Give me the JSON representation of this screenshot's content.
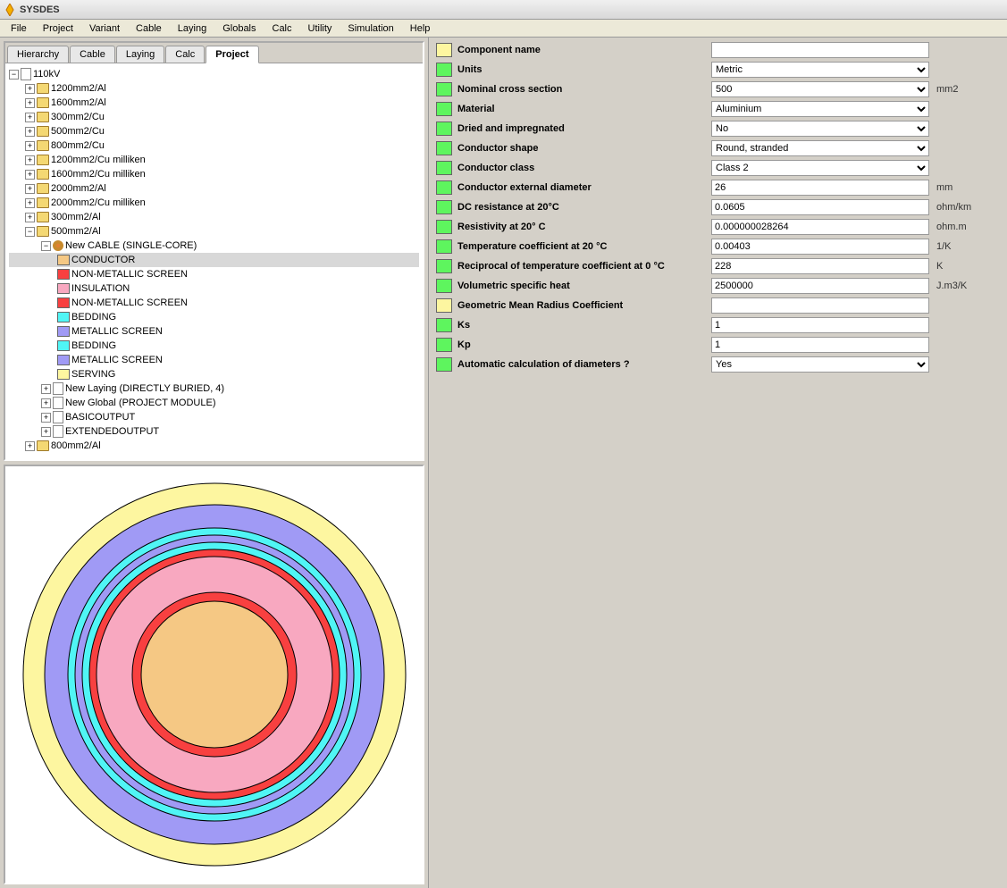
{
  "app": {
    "title": "SYSDES"
  },
  "menu": {
    "items": [
      "File",
      "Project",
      "Variant",
      "Cable",
      "Laying",
      "Globals",
      "Calc",
      "Utility",
      "Simulation",
      "Help"
    ]
  },
  "tabs": {
    "items": [
      "Hierarchy",
      "Cable",
      "Laying",
      "Calc",
      "Project"
    ],
    "active": 4
  },
  "tree": {
    "root": "110kV",
    "folders": [
      "1200mm2/Al",
      "1600mm2/Al",
      "300mm2/Cu",
      "500mm2/Cu",
      "800mm2/Cu",
      "1200mm2/Cu milliken",
      "1600mm2/Cu milliken",
      "2000mm2/Al",
      "2000mm2/Cu milliken",
      "300mm2/Al"
    ],
    "open_folder": "500mm2/Al",
    "cable_node": "New CABLE (SINGLE-CORE)",
    "layers": [
      {
        "label": "CONDUCTOR",
        "color": "c-orange",
        "selected": true
      },
      {
        "label": "NON-METALLIC SCREEN",
        "color": "c-red"
      },
      {
        "label": "INSULATION",
        "color": "c-pink"
      },
      {
        "label": "NON-METALLIC SCREEN",
        "color": "c-red"
      },
      {
        "label": "BEDDING",
        "color": "c-cyan"
      },
      {
        "label": "METALLIC SCREEN",
        "color": "c-purple"
      },
      {
        "label": "BEDDING",
        "color": "c-cyan"
      },
      {
        "label": "METALLIC SCREEN",
        "color": "c-purple"
      },
      {
        "label": "SERVING",
        "color": "c-yellow"
      }
    ],
    "siblings": [
      "New Laying (DIRECTLY BURIED, 4)",
      "New Global (PROJECT MODULE)",
      "BASICOUTPUT",
      "EXTENDEDOUTPUT"
    ],
    "last_folder": "800mm2/Al"
  },
  "props": [
    {
      "label": "Component name",
      "color": "c-yellow",
      "type": "text",
      "value": ""
    },
    {
      "label": "Units",
      "color": "c-green",
      "type": "select",
      "value": "Metric"
    },
    {
      "label": "Nominal cross section",
      "color": "c-green",
      "type": "select",
      "value": "500",
      "unit": "mm2"
    },
    {
      "label": "Material",
      "color": "c-green",
      "type": "select",
      "value": "Aluminium"
    },
    {
      "label": "Dried and impregnated",
      "color": "c-green",
      "type": "select",
      "value": "No"
    },
    {
      "label": "Conductor shape",
      "color": "c-green",
      "type": "select",
      "value": "Round, stranded"
    },
    {
      "label": "Conductor class",
      "color": "c-green",
      "type": "select",
      "value": "Class 2"
    },
    {
      "label": "Conductor external diameter",
      "color": "c-green",
      "type": "text",
      "value": "26",
      "unit": "mm"
    },
    {
      "label": "DC resistance at 20°C",
      "color": "c-green",
      "type": "text",
      "value": "0.0605",
      "unit": "ohm/km"
    },
    {
      "label": "Resistivity at 20° C",
      "color": "c-green",
      "type": "text",
      "value": "0.000000028264",
      "unit": "ohm.m"
    },
    {
      "label": "Temperature coefficient at 20 °C",
      "color": "c-green",
      "type": "text",
      "value": "0.00403",
      "unit": "1/K"
    },
    {
      "label": "Reciprocal of temperature coefficient at 0 °C",
      "color": "c-green",
      "type": "text",
      "value": "228",
      "unit": "K"
    },
    {
      "label": "Volumetric specific heat",
      "color": "c-green",
      "type": "text",
      "value": "2500000",
      "unit": "J.m3/K"
    },
    {
      "label": "Geometric Mean Radius Coefficient",
      "color": "c-yellow",
      "type": "text",
      "value": ""
    },
    {
      "label": "Ks",
      "color": "c-green",
      "type": "text",
      "value": "1"
    },
    {
      "label": "Kp",
      "color": "c-green",
      "type": "text",
      "value": "1"
    },
    {
      "label": "Automatic calculation of diameters ?",
      "color": "c-green",
      "type": "select",
      "value": "Yes"
    }
  ],
  "chart_data": {
    "type": "pie",
    "title": "Cable cross-section layers (outer→inner)",
    "layers_outer_to_inner": [
      {
        "name": "SERVING",
        "color": "#fdf6a0",
        "approx_outer_radius_px": 214
      },
      {
        "name": "METALLIC SCREEN",
        "color": "#a09af5",
        "approx_outer_radius_px": 190
      },
      {
        "name": "BEDDING",
        "color": "#50f5f5",
        "approx_outer_radius_px": 164
      },
      {
        "name": "METALLIC SCREEN",
        "color": "#a09af5",
        "approx_outer_radius_px": 156
      },
      {
        "name": "BEDDING",
        "color": "#50f5f5",
        "approx_outer_radius_px": 148
      },
      {
        "name": "NON-METALLIC SCREEN",
        "color": "#f84040",
        "approx_outer_radius_px": 140
      },
      {
        "name": "INSULATION",
        "color": "#f8a8c0",
        "approx_outer_radius_px": 132
      },
      {
        "name": "NON-METALLIC SCREEN",
        "color": "#f84040",
        "approx_outer_radius_px": 92
      },
      {
        "name": "CONDUCTOR",
        "color": "#f5c884",
        "approx_outer_radius_px": 82
      }
    ]
  }
}
